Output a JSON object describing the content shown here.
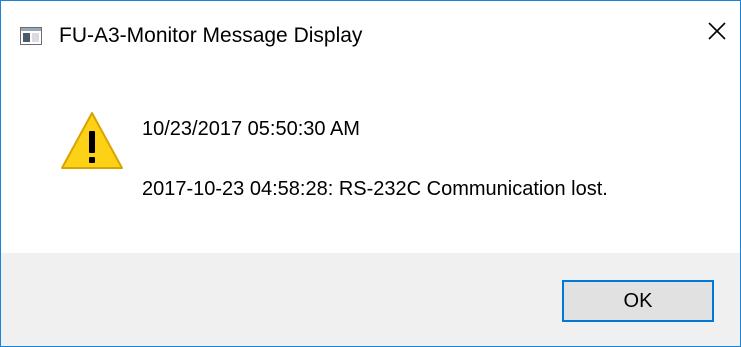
{
  "window": {
    "title": "FU-A3-Monitor Message Display",
    "icon": "app-window-icon",
    "close_icon": "close-icon"
  },
  "message": {
    "icon": "warning-icon",
    "line1": "10/23/2017 05:50:30 AM",
    "line2": "2017-10-23 04:58:28: RS-232C Communication lost."
  },
  "buttons": {
    "ok_label": "OK"
  },
  "colors": {
    "accent": "#0078d7",
    "window_border": "#1883d7",
    "footer_bg": "#f0f0f0",
    "warning_fill": "#fcd116"
  }
}
